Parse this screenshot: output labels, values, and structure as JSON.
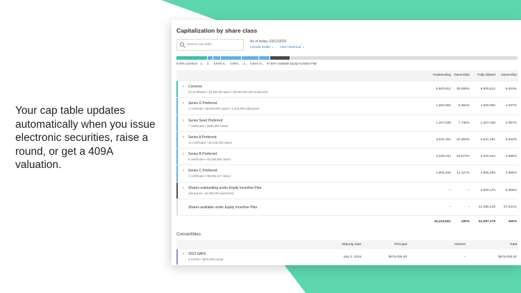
{
  "headline": "Your cap table updates automatically when you issue electronic securities, raise a round, or get a 409A valuation.",
  "colors": {
    "green": "#5dd6ad",
    "teal": "#3ec1a6",
    "blue": "#5eb0e8",
    "gray": "#6a6a6a",
    "purple": "#9b89c9",
    "dark": "#4b4b4b"
  },
  "card": {
    "title": "Capitalization by share class",
    "search_placeholder": "Search cap table",
    "as_of": "As of today, 03/12/2020",
    "include_drafts": "Include drafts ⌄",
    "view_historical": "View historical ⌄",
    "bar_segments": [
      {
        "label": "9.00% Common",
        "frac": 0.09,
        "color": "#3ec1a6"
      },
      {
        "label": "1...",
        "frac": 0.016,
        "color": "#5eb0e8"
      },
      {
        "label": "2...",
        "frac": 0.021,
        "color": "#5eb0e8"
      },
      {
        "label": "5.94% S...",
        "frac": 0.059,
        "color": "#5eb0e8"
      },
      {
        "label": "4.95%...",
        "frac": 0.05,
        "color": "#5eb0e8"
      },
      {
        "label": "2...",
        "frac": 0.03,
        "color": "#5eb0e8"
      },
      {
        "label": "5.91% O...",
        "frac": 0.059,
        "color": "#4b4b4b"
      },
      {
        "label": "67.54% Available Equity Incentive Plan",
        "frac": 0.675,
        "color": "#dcdcdc"
      }
    ],
    "columns": {
      "outstanding": "Outstanding",
      "ownership": "Ownership",
      "fully_diluted": "Fully diluted",
      "fd_ownership": "Ownership"
    },
    "rows": [
      {
        "name": "Common",
        "sub": "20 certificates • $1,185,bb raised • 00,000,000,000 authorized",
        "outstanding": "5,500,812",
        "ownership": "35.098%",
        "fully_diluted": "5,500,812",
        "fd_ownership": "9.003%",
        "color": "#3ec1a6",
        "chevron": "›"
      },
      {
        "name": "Series D Preferred",
        "sub": "1 certificate • $5,000,000 raised • 1,000,000 authorized",
        "outstanding": "1,000,000",
        "ownership": "6.364%",
        "fully_diluted": "1,000,000",
        "fd_ownership": "1.637%",
        "color": "#5eb0e8",
        "chevron": "›"
      },
      {
        "name": "Series Seed Preferred",
        "sub": "7 certificates • $350,300 raised",
        "outstanding": "1,257,038",
        "ownership": "7.748%",
        "fully_diluted": "1,257,038",
        "fd_ownership": "2.057%",
        "color": "#5eb0e8",
        "chevron": "›"
      },
      {
        "name": "Series A Preferred",
        "sub": "11 certificates • $1,548,250 raised",
        "outstanding": "3,631,191",
        "ownership": "22.382%",
        "fully_diluted": "3,631,191",
        "fd_ownership": "5.943%",
        "color": "#5eb0e8",
        "chevron": "›"
      },
      {
        "name": "Series B Preferred",
        "sub": "9 certificates • $3,099,809 raised",
        "outstanding": "3,029,344",
        "ownership": "18.672%",
        "fully_diluted": "3,029,344",
        "fd_ownership": "4.958%",
        "color": "#5eb0e8",
        "chevron": "›"
      },
      {
        "name": "Series C Preferred",
        "sub": "2 certificates • $8,084,317 raised",
        "outstanding": "1,805,206",
        "ownership": "11.127%",
        "fully_diluted": "1,805,206",
        "fd_ownership": "2.955%",
        "color": "#5eb0e8",
        "chevron": "›"
      },
      {
        "name": "Shares outstanding under Equity Incentive Plan",
        "sub": "196 grants • 45,000,000 authorized",
        "outstanding": "–",
        "ownership": "–",
        "fully_diluted": "3,609,170",
        "fd_ownership": "5.906%",
        "color": "#4b4b4b",
        "chevron": "›"
      },
      {
        "name": "Shares available under Equity Incentive Plan",
        "sub": "",
        "outstanding": "–",
        "ownership": "–",
        "fully_diluted": "41,265,418",
        "fd_ownership": "67.541%",
        "color": "#dcdcdc",
        "chevron": ""
      }
    ],
    "totals": {
      "outstanding": "16,223,501",
      "ownership": "100%",
      "fully_diluted": "61,097,179",
      "fd_ownership": "100%"
    },
    "convertibles_title": "Convertibles",
    "conv_columns": {
      "maturity": "Maturity date",
      "principal": "Principal",
      "interest": "Interest",
      "total": "Total"
    },
    "conv_row": {
      "name": "2013 SAFE",
      "sub": "3 SAFEs • $675,000 raised",
      "maturity": "July 2, 2018",
      "principal": "$675,000.00",
      "interest": "–",
      "total": "$675,000.00"
    }
  }
}
